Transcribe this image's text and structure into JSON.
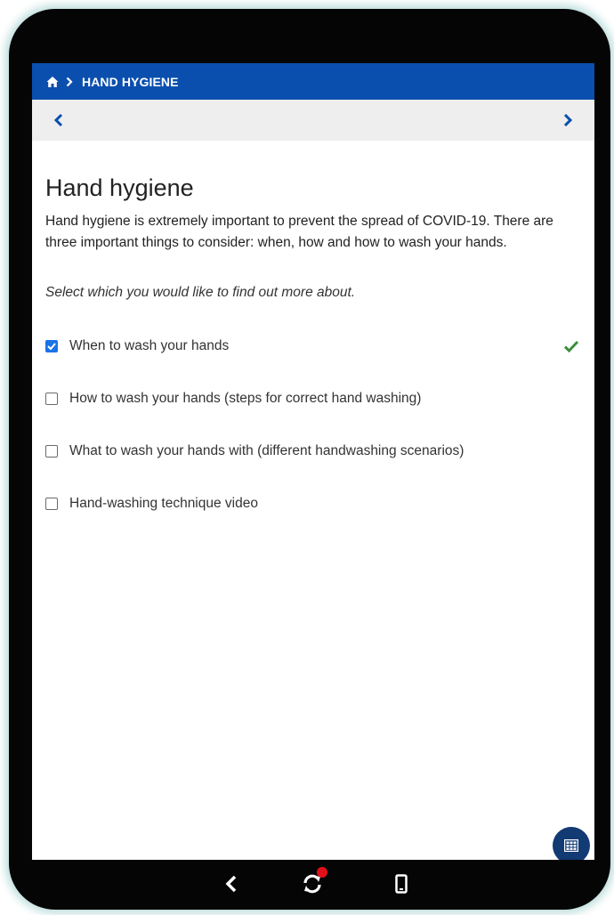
{
  "breadcrumb": {
    "home_icon": "home-icon",
    "separator_icon": "chevron-right-icon",
    "current": "HAND HYGIENE"
  },
  "navigation": {
    "prev_icon": "chevron-left-icon",
    "next_icon": "chevron-right-icon"
  },
  "content": {
    "title": "Hand hygiene",
    "intro": "Hand hygiene is extremely important to prevent the spread of COVID-19. There are three important things to consider: when, how and how to wash your hands.",
    "instruction": "Select which you would like to find out more about.",
    "options": [
      {
        "label": "When to wash your hands",
        "checked": true,
        "completed": true
      },
      {
        "label": "How to wash your hands (steps for correct hand washing)",
        "checked": false,
        "completed": false
      },
      {
        "label": "What to wash your hands with (different handwashing scenarios)",
        "checked": false,
        "completed": false
      },
      {
        "label": "Hand-washing technique video",
        "checked": false,
        "completed": false
      }
    ]
  },
  "fab": {
    "icon": "grid-icon"
  },
  "system_nav": {
    "back_icon": "back-chevron-icon",
    "rotate_icon": "rotate-icon",
    "device_icon": "phone-icon",
    "notification_color": "#e0101a"
  },
  "colors": {
    "brand_blue": "#0a4fae",
    "check_blue": "#1a73e8",
    "done_green": "#3a8f3a",
    "fab_navy": "#123a73"
  }
}
